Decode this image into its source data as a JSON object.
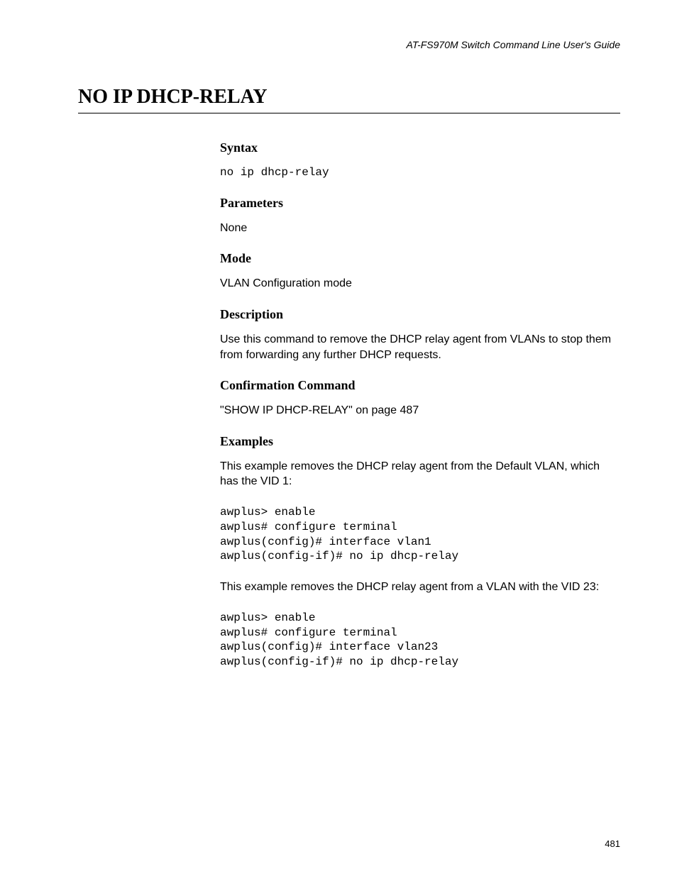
{
  "header": "AT-FS970M Switch Command Line User's Guide",
  "title": "NO IP DHCP-RELAY",
  "sections": {
    "syntax": {
      "head": "Syntax",
      "code": "no ip dhcp-relay"
    },
    "parameters": {
      "head": "Parameters",
      "text": "None"
    },
    "mode": {
      "head": "Mode",
      "text": "VLAN Configuration mode"
    },
    "description": {
      "head": "Description",
      "text": "Use this command to remove the DHCP relay agent from VLANs to stop them from forwarding any further DHCP requests."
    },
    "confirmation": {
      "head": "Confirmation Command",
      "text": "\"SHOW IP DHCP-RELAY\" on page 487"
    },
    "examples": {
      "head": "Examples",
      "intro1": "This example removes the DHCP relay agent from the Default VLAN, which has the VID 1:",
      "code1": "awplus> enable\nawplus# configure terminal\nawplus(config)# interface vlan1\nawplus(config-if)# no ip dhcp-relay",
      "intro2": "This example removes the DHCP relay agent from a VLAN with the VID 23:",
      "code2": "awplus> enable\nawplus# configure terminal\nawplus(config)# interface vlan23\nawplus(config-if)# no ip dhcp-relay"
    }
  },
  "pageNumber": "481"
}
